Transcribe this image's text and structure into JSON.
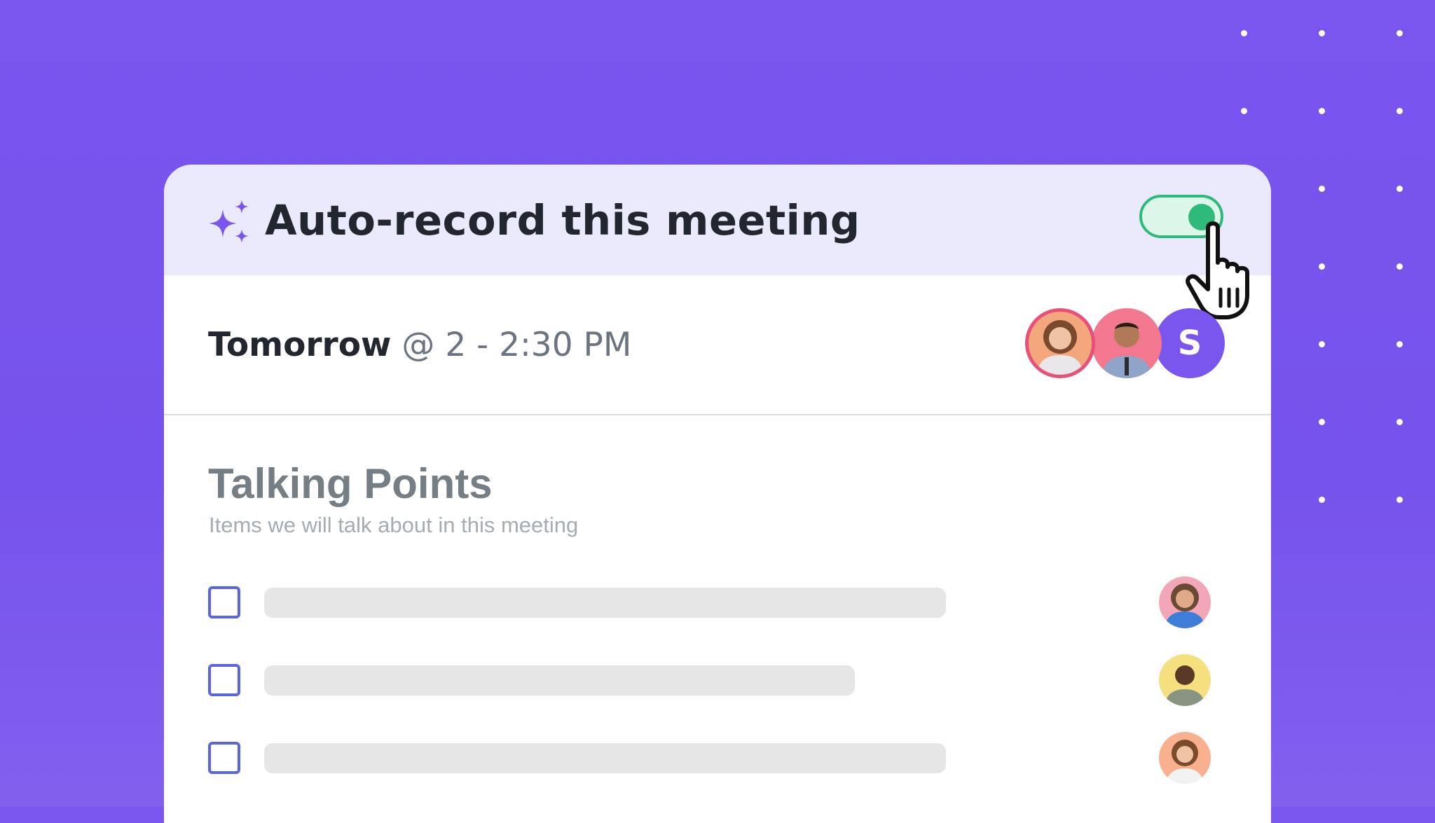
{
  "header": {
    "icon": "sparkle-icon",
    "title": "Auto-record this meeting",
    "toggle_on": true,
    "toggle_color": "#2dba7b"
  },
  "meeting": {
    "day": "Tomorrow",
    "time": "@ 2 - 2:30 PM",
    "attendees": [
      {
        "type": "photo",
        "name": "attendee-woman-glasses"
      },
      {
        "type": "photo",
        "name": "attendee-man-beard"
      },
      {
        "type": "initial",
        "initial": "S"
      }
    ]
  },
  "talking_points": {
    "title": "Talking Points",
    "subtitle": "Items we will talk about in this meeting",
    "items": [
      {
        "checked": false,
        "text_placeholder_fill": 0.74,
        "assignee": "avatar-woman-curly"
      },
      {
        "checked": false,
        "text_placeholder_fill": 0.64,
        "assignee": "avatar-man-smiling"
      },
      {
        "checked": false,
        "text_placeholder_fill": 0.74,
        "assignee": "avatar-woman-red-hair"
      }
    ]
  },
  "colors": {
    "background": "#7a55ee",
    "header_bg": "#ebe9fc",
    "accent_purple": "#7a55ee",
    "checkbox_border": "#5a64e4"
  }
}
